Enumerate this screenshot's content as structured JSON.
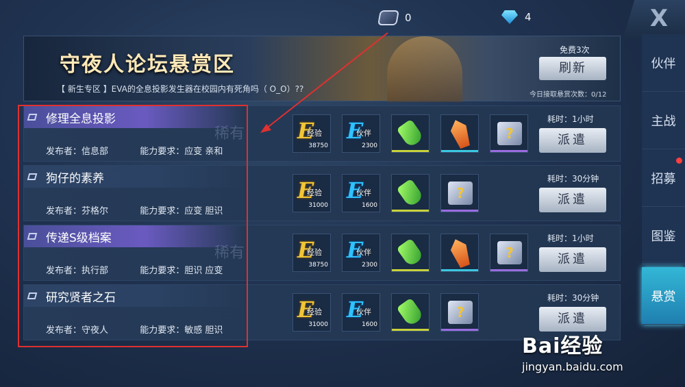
{
  "currency": {
    "crystal": "0",
    "diamond": "4"
  },
  "close_label": "X",
  "sidenav": [
    {
      "label": "伙伴"
    },
    {
      "label": "主战"
    },
    {
      "label": "招募",
      "dot": true
    },
    {
      "label": "图鉴"
    },
    {
      "label": "悬赏",
      "active": true
    }
  ],
  "banner": {
    "title": "守夜人论坛悬赏区",
    "subtitle": "【 新生专区 】EVA的全息投影发生器在校园内有死角吗（ O_O）??",
    "free_label": "免费3次",
    "refresh_label": "刷新",
    "today_count": "今日接取悬赏次数：0/12"
  },
  "quests": [
    {
      "title": "修理全息投影",
      "publisher": "发布者：信息部",
      "requirement": "能力要求：应变  亲和",
      "rarity": "稀有",
      "rewards": [
        {
          "kind": "exp",
          "label": "经验",
          "value": "38750"
        },
        {
          "kind": "partner",
          "label": "伙伴",
          "value": "2300"
        },
        {
          "kind": "potion"
        },
        {
          "kind": "crystal"
        },
        {
          "kind": "box"
        }
      ],
      "time": "耗时：1小时",
      "dispatch": "派遣"
    },
    {
      "title": "狗仔的素养",
      "publisher": "发布者：芬格尔",
      "requirement": "能力要求：应变  胆识",
      "rarity": "",
      "rewards": [
        {
          "kind": "exp",
          "label": "经验",
          "value": "31000"
        },
        {
          "kind": "partner",
          "label": "伙伴",
          "value": "1600"
        },
        {
          "kind": "potion"
        },
        {
          "kind": "box"
        }
      ],
      "time": "耗时：30分钟",
      "dispatch": "派遣"
    },
    {
      "title": "传递S级档案",
      "publisher": "发布者：执行部",
      "requirement": "能力要求：胆识  应变",
      "rarity": "稀有",
      "rewards": [
        {
          "kind": "exp",
          "label": "经验",
          "value": "38750"
        },
        {
          "kind": "partner",
          "label": "伙伴",
          "value": "2300"
        },
        {
          "kind": "potion"
        },
        {
          "kind": "crystal"
        },
        {
          "kind": "box"
        }
      ],
      "time": "耗时：1小时",
      "dispatch": "派遣"
    },
    {
      "title": "研究贤者之石",
      "publisher": "发布者：守夜人",
      "requirement": "能力要求：敏感  胆识",
      "rarity": "",
      "rewards": [
        {
          "kind": "exp",
          "label": "经验",
          "value": "31000"
        },
        {
          "kind": "partner",
          "label": "伙伴",
          "value": "1600"
        },
        {
          "kind": "potion"
        },
        {
          "kind": "box"
        }
      ],
      "time": "耗时：30分钟",
      "dispatch": "派遣"
    }
  ],
  "watermark": {
    "main": "Bai经验",
    "sub": "jingyan.baidu.com"
  },
  "colors": {
    "annotation": "#e03030",
    "accent": "#33b7d6"
  }
}
